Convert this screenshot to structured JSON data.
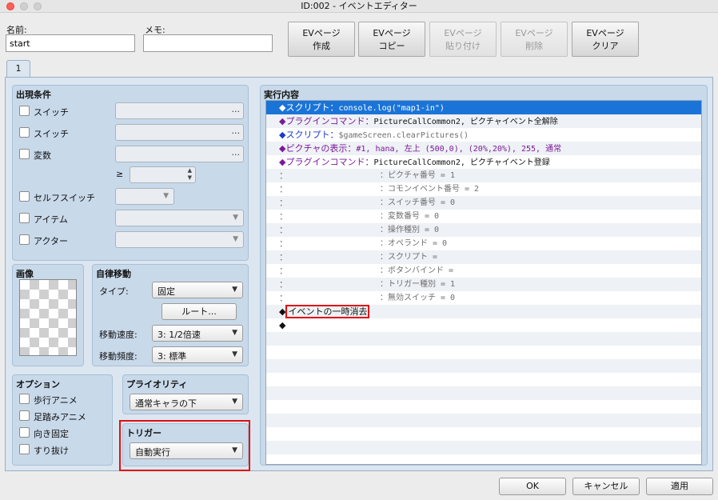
{
  "window": {
    "title": "ID:002 - イベントエディター"
  },
  "header": {
    "name_label": "名前:",
    "name_value": "start",
    "memo_label": "メモ:",
    "memo_value": "",
    "buttons": [
      {
        "line1": "EVページ",
        "line2": "作成",
        "enabled": true
      },
      {
        "line1": "EVページ",
        "line2": "コピー",
        "enabled": true
      },
      {
        "line1": "EVページ",
        "line2": "貼り付け",
        "enabled": false
      },
      {
        "line1": "EVページ",
        "line2": "削除",
        "enabled": false
      },
      {
        "line1": "EVページ",
        "line2": "クリア",
        "enabled": true
      }
    ]
  },
  "tabs": [
    {
      "label": "1"
    }
  ],
  "conditions": {
    "title": "出現条件",
    "switch1": "スイッチ",
    "switch2": "スイッチ",
    "variable": "変数",
    "ge": "≥",
    "self_switch": "セルフスイッチ",
    "item": "アイテム",
    "actor": "アクター",
    "dots": "..."
  },
  "image": {
    "title": "画像"
  },
  "autonomous": {
    "title": "自律移動",
    "type_label": "タイプ:",
    "type_value": "固定",
    "route_label": "ルート...",
    "speed_label": "移動速度:",
    "speed_value": "3: 1/2倍速",
    "freq_label": "移動頻度:",
    "freq_value": "3: 標準"
  },
  "options": {
    "title": "オプション",
    "walking": "歩行アニメ",
    "stepping": "足踏みアニメ",
    "direction_fix": "向き固定",
    "through": "すり抜け"
  },
  "priority": {
    "title": "プライオリティ",
    "value": "通常キャラの下"
  },
  "trigger": {
    "title": "トリガー",
    "value": "自動実行"
  },
  "contents": {
    "title": "実行内容",
    "rows": [
      {
        "head": "◆スクリプト：",
        "body": "console.log(\"map1-in\")"
      },
      {
        "head": "◆プラグインコマンド：",
        "body": "PictureCallCommon2, ピクチャイベント全解除"
      },
      {
        "head": "◆スクリプト：",
        "body": "$gameScreen.clearPictures()"
      },
      {
        "head": "◆ピクチャの表示：",
        "body": "#1, hana, 左上 (500,0), (20%,20%), 255, 通常"
      },
      {
        "head": "◆プラグインコマンド：",
        "body": "PictureCallCommon2, ピクチャイベント登録"
      },
      {
        "head": "：",
        "body": "：ピクチャ番号 = 1"
      },
      {
        "head": "：",
        "body": "：コモンイベント番号 = 2"
      },
      {
        "head": "：",
        "body": "：スイッチ番号 = 0"
      },
      {
        "head": "：",
        "body": "：変数番号 = 0"
      },
      {
        "head": "：",
        "body": "：操作種別 = 0"
      },
      {
        "head": "：",
        "body": "：オペランド = 0"
      },
      {
        "head": "：",
        "body": "：スクリプト ="
      },
      {
        "head": "：",
        "body": "：ボタンバインド ="
      },
      {
        "head": "：",
        "body": "：トリガー種別 = 1"
      },
      {
        "head": "：",
        "body": "：無効スイッチ = 0"
      },
      {
        "head": "◆",
        "body": "イベントの一時消去"
      },
      {
        "head": "◆",
        "body": ""
      }
    ]
  },
  "footer": {
    "ok": "OK",
    "cancel": "キャンセル",
    "apply": "適用"
  },
  "colors": {
    "selection": "#1a74d8",
    "highlight_box": "#e01010",
    "script": "#1a3ad0",
    "plugin": "#7a1a9a"
  }
}
